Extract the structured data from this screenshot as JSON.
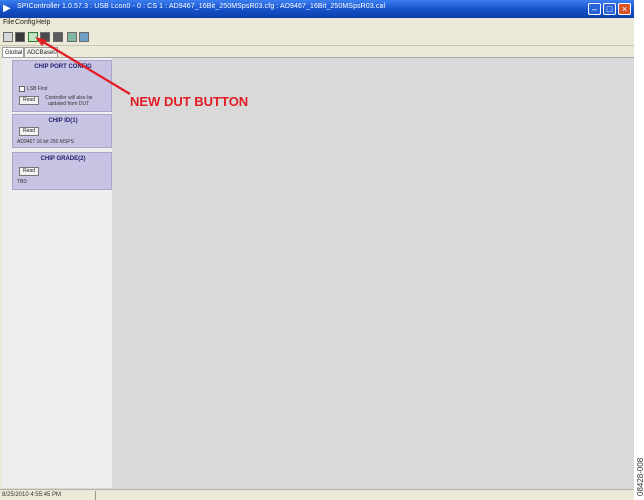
{
  "window": {
    "title": "SPIController 1.0.57.3 : USB Lcon0 - 0 : CS 1 : AD9467_16Bit_250MSpsR03.cfg : AD9467_16Bit_250MSpsR03.cal"
  },
  "menu": [
    "File",
    "Config",
    "Help"
  ],
  "tabs": [
    "Global",
    "ADCBase0"
  ],
  "panels": {
    "chip_port_config": {
      "title": "CHIP PORT CONFIG",
      "checkbox_label": "LSB First",
      "button": "Read",
      "note_line1": "Controller will also be",
      "note_line2": "updated from DUT"
    },
    "chip_id": {
      "title": "CHIP ID(1)",
      "button": "Read",
      "value": "AD9467 16 bit 250 MSPS"
    },
    "chip_grade": {
      "title": "CHIP GRADE(2)",
      "button": "Read",
      "value": "TBD"
    }
  },
  "annotation": {
    "text": "NEW DUT BUTTON",
    "color": "#e31c24"
  },
  "status": {
    "timestamp": "8/25/2010 4:55:45 PM"
  },
  "side_code": "08428-008"
}
